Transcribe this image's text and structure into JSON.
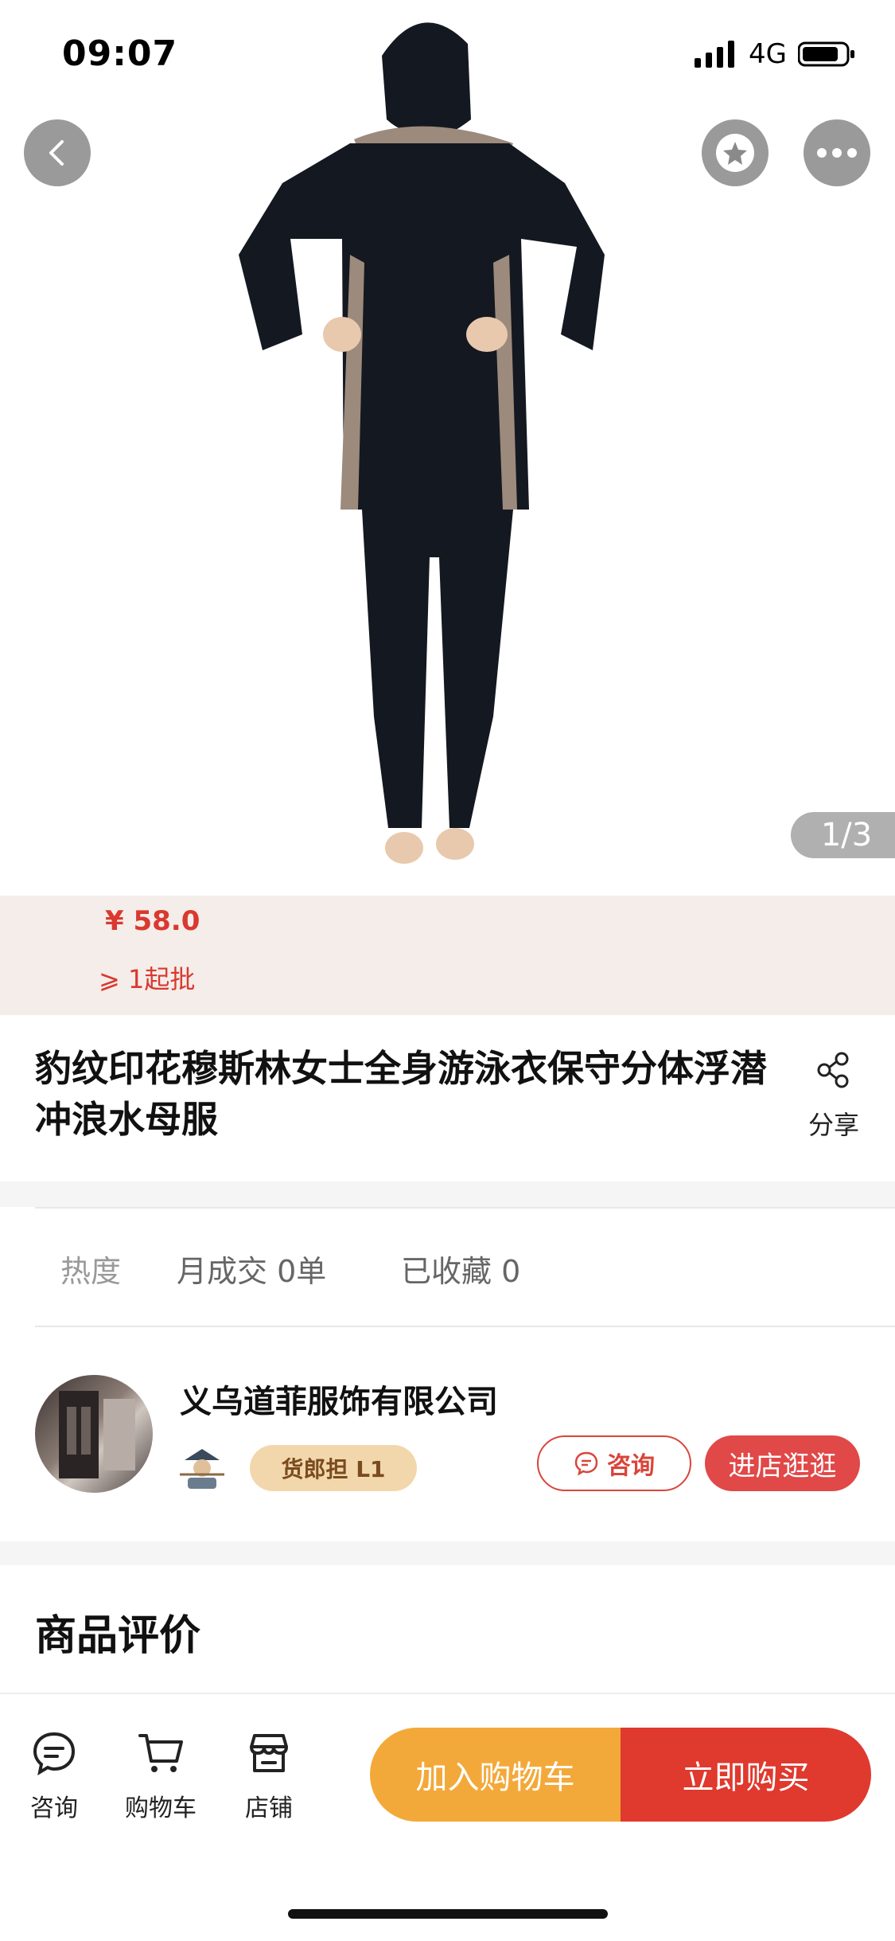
{
  "status": {
    "time": "09:07",
    "network": "4G"
  },
  "gallery": {
    "counter": "1/3"
  },
  "price": {
    "value": "¥ 58.0",
    "moq": "⩾ 1起批"
  },
  "product": {
    "title": "豹纹印花穆斯林女士全身游泳衣保守分体浮潜冲浪水母服",
    "share_label": "分享"
  },
  "stats": [
    "热度",
    "月成交 0单",
    "已收藏 0"
  ],
  "shop": {
    "name": "义乌道菲服饰有限公司",
    "level": "货郎担 L1",
    "consult_label": "咨询",
    "enter_label": "进店逛逛"
  },
  "reviews": {
    "title": "商品评价"
  },
  "bottom_bar": {
    "tabs": [
      {
        "label": "咨询",
        "icon": "chat-icon"
      },
      {
        "label": "购物车",
        "icon": "cart-icon"
      },
      {
        "label": "店铺",
        "icon": "store-icon"
      }
    ],
    "add_cart_label": "加入购物车",
    "buy_now_label": "立即购买"
  },
  "colors": {
    "price_red": "#d9392f",
    "enter_shop": "#e14848",
    "add_to_cart": "#f3a93a",
    "buy_now": "#e0392e",
    "level_badge": "#f2d7ad",
    "price_band": "#f4ede9"
  }
}
